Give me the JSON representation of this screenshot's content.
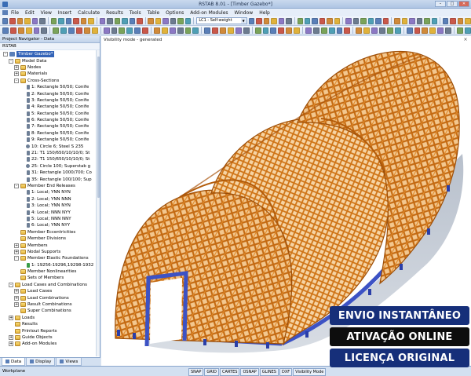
{
  "window": {
    "title": "RSTAB 8.01 - [Timber Gazebo*]"
  },
  "menu": [
    "File",
    "Edit",
    "View",
    "Insert",
    "Calculate",
    "Results",
    "Tools",
    "Table",
    "Options",
    "Add-on Modules",
    "Window",
    "Help"
  ],
  "toolbar": {
    "loadcase": "LC1 - Self-weight"
  },
  "navigator": {
    "header": "Project Navigator - Data",
    "root": "RSTAB",
    "model": "Timber Gazebo*",
    "items": [
      {
        "level": 1,
        "label": "Model Data",
        "exp": "-",
        "icon": "folder"
      },
      {
        "level": 2,
        "label": "Nodes",
        "exp": "+",
        "icon": "folder"
      },
      {
        "level": 2,
        "label": "Materials",
        "exp": "+",
        "icon": "folder"
      },
      {
        "level": 2,
        "label": "Cross-Sections",
        "exp": "-",
        "icon": "folder"
      },
      {
        "level": 3,
        "label": "1: Rectangle 50/50; Conife",
        "icon": "leaf"
      },
      {
        "level": 3,
        "label": "2: Rectangle 50/50; Conife",
        "icon": "leaf"
      },
      {
        "level": 3,
        "label": "3: Rectangle 50/50; Conife",
        "icon": "leaf"
      },
      {
        "level": 3,
        "label": "4: Rectangle 50/50; Conife",
        "icon": "leaf"
      },
      {
        "level": 3,
        "label": "5: Rectangle 50/50; Conife",
        "icon": "leaf"
      },
      {
        "level": 3,
        "label": "6: Rectangle 50/50; Conife",
        "icon": "leaf"
      },
      {
        "level": 3,
        "label": "7: Rectangle 50/50; Conife",
        "icon": "leaf"
      },
      {
        "level": 3,
        "label": "8: Rectangle 50/50; Conife",
        "icon": "leaf"
      },
      {
        "level": 3,
        "label": "9: Rectangle 50/50; Conife",
        "icon": "leaf"
      },
      {
        "level": 3,
        "label": "10: Circle 6; Steel S 235",
        "icon": "circle"
      },
      {
        "level": 3,
        "label": "21: T1 150/650/10/10/0; St",
        "icon": "leaf"
      },
      {
        "level": 3,
        "label": "22: T1 150/650/10/10/0; St",
        "icon": "leaf"
      },
      {
        "level": 3,
        "label": "25: Circle 100; Superstab g",
        "icon": "circle"
      },
      {
        "level": 3,
        "label": "31: Rectangle 1000/700; Co",
        "icon": "leaf"
      },
      {
        "level": 3,
        "label": "35: Rectangle 100/100; Sup",
        "icon": "leaf"
      },
      {
        "level": 2,
        "label": "Member End Releases",
        "exp": "-",
        "icon": "folder"
      },
      {
        "level": 3,
        "label": "1: Local; YNN NYN",
        "icon": "leaf"
      },
      {
        "level": 3,
        "label": "2: Local; YNN NNN",
        "icon": "leaf"
      },
      {
        "level": 3,
        "label": "3: Local; YNN NYN",
        "icon": "leaf"
      },
      {
        "level": 3,
        "label": "4: Local; NNN NYY",
        "icon": "leaf"
      },
      {
        "level": 3,
        "label": "5: Local; NNN NNY",
        "icon": "leaf"
      },
      {
        "level": 3,
        "label": "6: Local; YNN NYY",
        "icon": "leaf"
      },
      {
        "level": 2,
        "label": "Member Eccentricities",
        "icon": "folder"
      },
      {
        "level": 2,
        "label": "Member Divisions",
        "icon": "folder"
      },
      {
        "level": 2,
        "label": "Members",
        "exp": "+",
        "icon": "folder"
      },
      {
        "level": 2,
        "label": "Nodal Supports",
        "exp": "+",
        "icon": "folder"
      },
      {
        "level": 2,
        "label": "Member Elastic Foundations",
        "exp": "-",
        "icon": "folder"
      },
      {
        "level": 3,
        "label": "1: 19256-19296,19298-1932",
        "icon": "green"
      },
      {
        "level": 2,
        "label": "Member Nonlinearities",
        "icon": "folder"
      },
      {
        "level": 2,
        "label": "Sets of Members",
        "icon": "folder"
      },
      {
        "level": 1,
        "label": "Load Cases and Combinations",
        "exp": "-",
        "icon": "folder"
      },
      {
        "level": 2,
        "label": "Load Cases",
        "exp": "+",
        "icon": "folder"
      },
      {
        "level": 2,
        "label": "Load Combinations",
        "exp": "+",
        "icon": "folder"
      },
      {
        "level": 2,
        "label": "Result Combinations",
        "exp": "+",
        "icon": "folder"
      },
      {
        "level": 2,
        "label": "Super Combinations",
        "icon": "folder"
      },
      {
        "level": 1,
        "label": "Loads",
        "exp": "+",
        "icon": "folder"
      },
      {
        "level": 1,
        "label": "Results",
        "icon": "folder"
      },
      {
        "level": 1,
        "label": "Printout Reports",
        "icon": "folder"
      },
      {
        "level": 1,
        "label": "Guide Objects",
        "exp": "+",
        "icon": "folder"
      },
      {
        "level": 1,
        "label": "Add-on Modules",
        "exp": "+",
        "icon": "folder"
      }
    ],
    "tabs": [
      "Data",
      "Display",
      "Views"
    ]
  },
  "viewport": {
    "label": "Visibility mode - generated"
  },
  "status": {
    "text": "Workplane",
    "buttons": [
      "SNAP",
      "GRID",
      "CARTES",
      "OSNAP",
      "GLINES",
      "DXF",
      "Visibility Mode"
    ]
  },
  "badges": {
    "instant": "ENVIO INSTANTÂNEO",
    "activation": "ATIVAÇÃO ONLINE",
    "license": "LICENÇA ORIGINAL"
  },
  "colors": {
    "timber": "#d97c1c",
    "steel_base": "#3c52c4",
    "badge_navy": "#162f7a",
    "badge_black": "#0d0d0d"
  }
}
